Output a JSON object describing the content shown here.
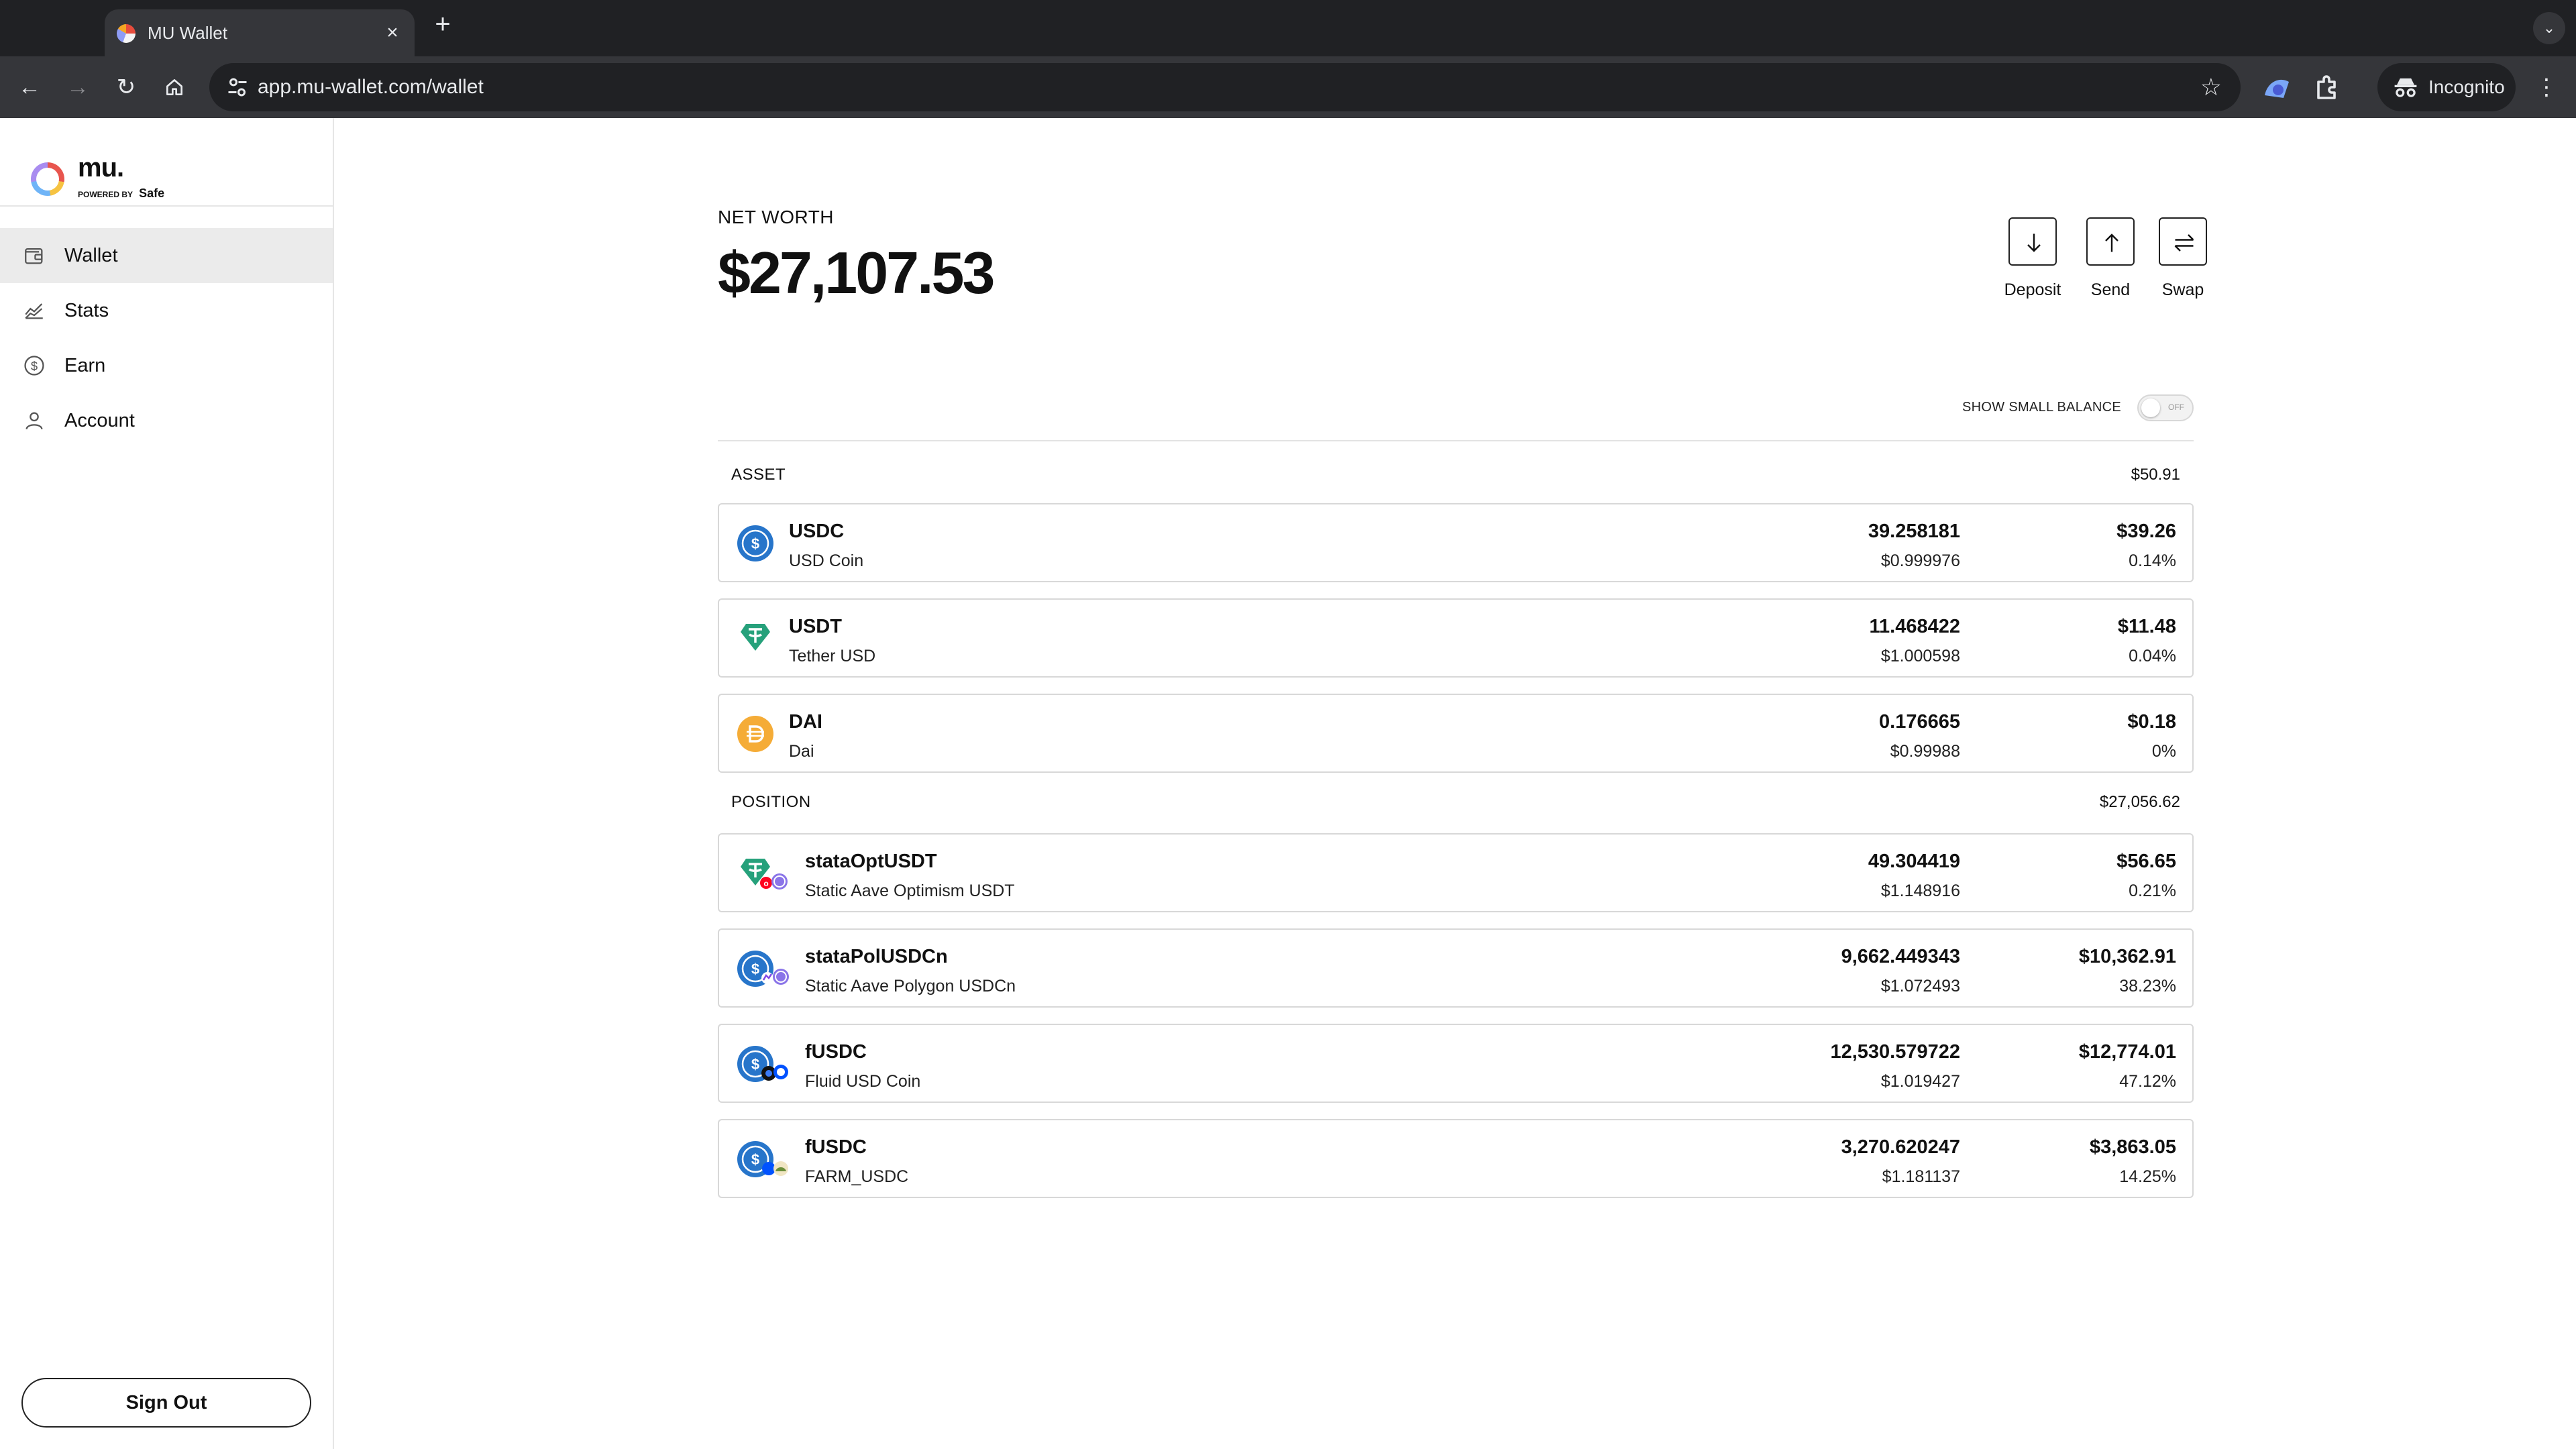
{
  "browser": {
    "tab_title": "MU Wallet",
    "tab_close": "×",
    "new_tab": "+",
    "url": "app.mu-wallet.com/wallet",
    "incognito_label": "Incognito"
  },
  "brand": {
    "name": "mu.",
    "powered_by": "POWERED BY",
    "partner": "Safe"
  },
  "sidebar": {
    "items": [
      {
        "label": "Wallet",
        "icon": "wallet-icon",
        "active": true
      },
      {
        "label": "Stats",
        "icon": "chart-icon",
        "active": false
      },
      {
        "label": "Earn",
        "icon": "dollar-coin-icon",
        "active": false
      },
      {
        "label": "Account",
        "icon": "person-icon",
        "active": false
      }
    ],
    "sign_out": "Sign Out"
  },
  "header": {
    "net_worth_label": "NET WORTH",
    "net_worth_value": "$27,107.53",
    "actions": [
      {
        "label": "Deposit",
        "icon": "arrow-down-icon"
      },
      {
        "label": "Send",
        "icon": "arrow-up-icon"
      },
      {
        "label": "Swap",
        "icon": "swap-arrows-icon"
      }
    ]
  },
  "small_balance": {
    "label": "SHOW SMALL BALANCE",
    "toggle_state": "OFF"
  },
  "assets": {
    "title": "ASSET",
    "total": "$50.91",
    "rows": [
      {
        "symbol": "USDC",
        "name": "USD Coin",
        "amount": "39.258181",
        "price": "$0.999976",
        "value": "$39.26",
        "pct": "0.14%",
        "icon": "usdc-icon"
      },
      {
        "symbol": "USDT",
        "name": "Tether USD",
        "amount": "11.468422",
        "price": "$1.000598",
        "value": "$11.48",
        "pct": "0.04%",
        "icon": "usdt-icon"
      },
      {
        "symbol": "DAI",
        "name": "Dai",
        "amount": "0.176665",
        "price": "$0.99988",
        "value": "$0.18",
        "pct": "0%",
        "icon": "dai-icon"
      }
    ]
  },
  "positions": {
    "title": "POSITION",
    "total": "$27,056.62",
    "rows": [
      {
        "symbol": "stataOptUSDT",
        "name": "Static Aave Optimism USDT",
        "amount": "49.304419",
        "price": "$1.148916",
        "value": "$56.65",
        "pct": "0.21%",
        "icon": "usdt-aave-optimism-icon"
      },
      {
        "symbol": "stataPolUSDCn",
        "name": "Static Aave Polygon USDCn",
        "amount": "9,662.449343",
        "price": "$1.072493",
        "value": "$10,362.91",
        "pct": "38.23%",
        "icon": "usdc-aave-polygon-icon"
      },
      {
        "symbol": "fUSDC",
        "name": "Fluid USD Coin",
        "amount": "12,530.579722",
        "price": "$1.019427",
        "value": "$12,774.01",
        "pct": "47.12%",
        "icon": "usdc-fluid-base-icon"
      },
      {
        "symbol": "fUSDC",
        "name": "FARM_USDC",
        "amount": "3,270.620247",
        "price": "$1.181137",
        "value": "$3,863.05",
        "pct": "14.25%",
        "icon": "usdc-harvest-base-icon"
      }
    ]
  },
  "colors": {
    "usdc": "#2775ca",
    "usdt": "#26a17b",
    "dai": "#f5ac37",
    "aave": "#b6509e",
    "optimism": "#ff0420",
    "polygon": "#8247e5",
    "base": "#0052ff"
  }
}
